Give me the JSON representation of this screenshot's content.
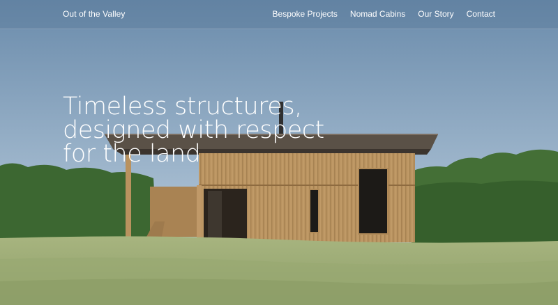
{
  "nav": {
    "brand": "Out of the Valley",
    "links": [
      "Bespoke Projects",
      "Nomad Cabins",
      "Our Story",
      "Contact"
    ]
  },
  "hero": {
    "headline_lines": [
      "Timeless structures,",
      "designed with respect",
      "for the land"
    ],
    "image": "timber-cabin-in-meadow"
  },
  "colors": {
    "sky_top": "#6c8cac",
    "sky_bottom": "#c7d6e2",
    "cedar": "#b7915f",
    "grass": "#9fb078",
    "hedge": "#3f6a33"
  }
}
